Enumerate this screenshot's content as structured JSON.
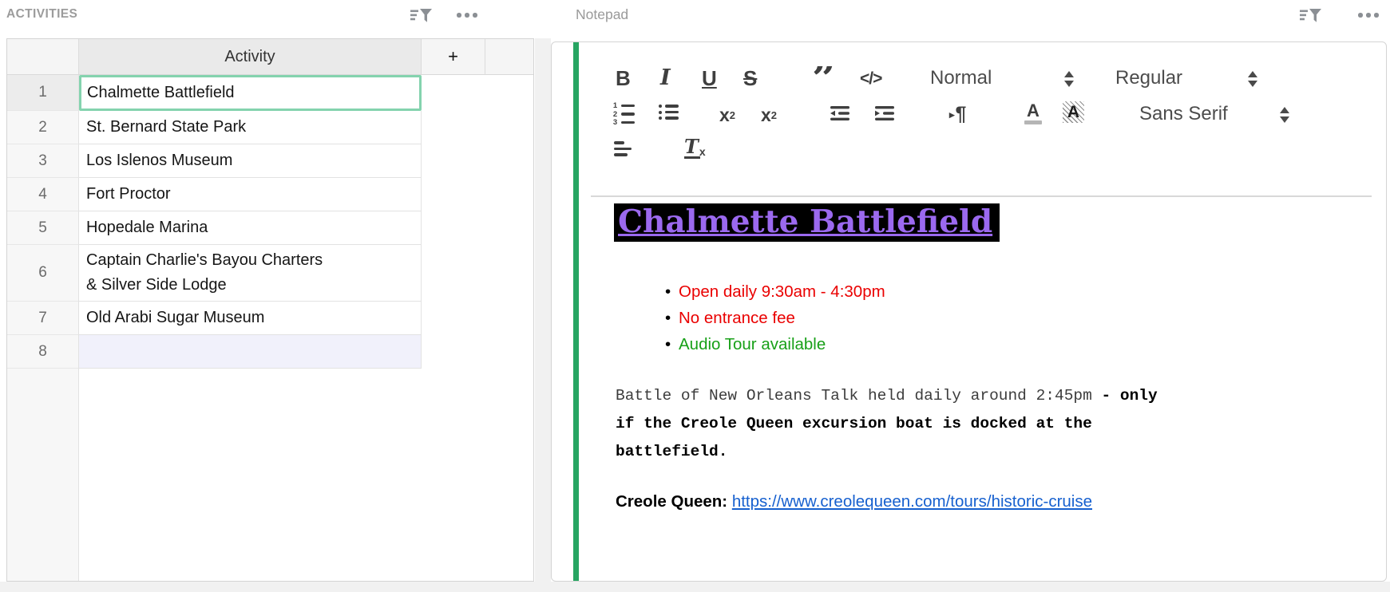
{
  "left_panel": {
    "title": "ACTIVITIES",
    "table": {
      "column_header": "Activity",
      "add_column_label": "+",
      "rows": [
        {
          "num": "1",
          "activity": "Chalmette Battlefield",
          "selected": true
        },
        {
          "num": "2",
          "activity": "St. Bernard State Park"
        },
        {
          "num": "3",
          "activity": "Los Islenos Museum"
        },
        {
          "num": "4",
          "activity": "Fort Proctor"
        },
        {
          "num": "5",
          "activity": "Hopedale Marina"
        },
        {
          "num": "6",
          "activity": "Captain Charlie's Bayou Charters\n& Silver Side Lodge"
        },
        {
          "num": "7",
          "activity": "Old Arabi Sugar Museum"
        },
        {
          "num": "8",
          "activity": "",
          "tinted": true
        }
      ]
    }
  },
  "right_panel": {
    "title": "Notepad",
    "toolbar": {
      "bold": "B",
      "italic": "I",
      "underline": "U",
      "strikethrough": "S",
      "blockquote": "”",
      "code_view": "</>",
      "paragraph_style": "Normal",
      "font_weight": "Regular",
      "font_family": "Sans Serif",
      "subscript_base": "x",
      "subscript_digit": "2",
      "superscript_base": "x",
      "superscript_digit": "2",
      "direction_arrow": "▸",
      "direction_pilcrow": "¶",
      "text_color_letter": "A",
      "background_color_letter": "A",
      "clear_format_t": "T",
      "clear_format_x": "x"
    },
    "note": {
      "heading": "Chalmette Battlefield",
      "bullets": [
        {
          "text": "Open daily 9:30am - 4:30pm",
          "color": "#ea0000"
        },
        {
          "text": "No entrance fee",
          "color": "#ea0000"
        },
        {
          "text": "Audio Tour available",
          "color": "#18a018"
        }
      ],
      "mono_regular": "Battle of New Orleans Talk held daily around 2:45pm ",
      "mono_bold": "- only if the Creole Queen excursion boat is docked at the battlefield.",
      "link_label": "Creole Queen:",
      "link_url": "https://www.creolequeen.com/tours/historic-cruise"
    },
    "colors": {
      "accent_green": "#27a562",
      "heading_purple": "#9b69ef",
      "heading_background": "#000000",
      "link_blue": "#1660cf"
    }
  }
}
